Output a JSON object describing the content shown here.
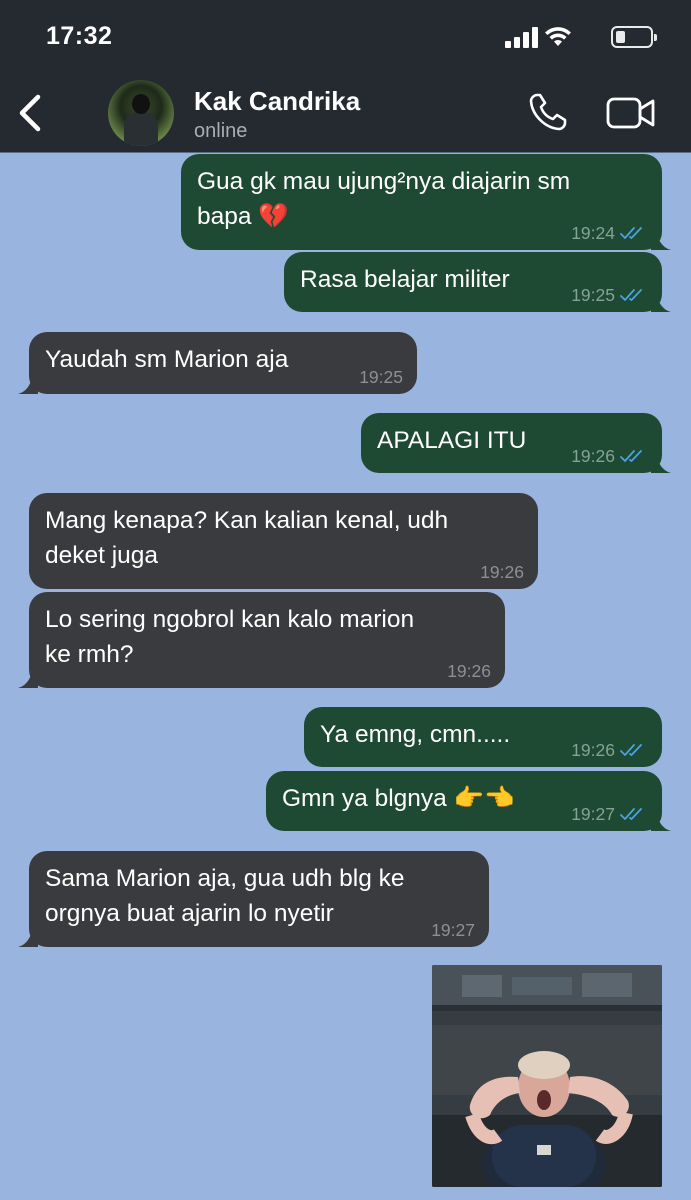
{
  "status_bar": {
    "time": "17:32",
    "battery_level": 0.3
  },
  "header": {
    "contact_name": "Kak Candrika",
    "contact_status": "online"
  },
  "colors": {
    "chat_background": "#98b4df",
    "outgoing_bubble": "#1e4a33",
    "incoming_bubble": "#3a3b3e",
    "read_ticks": "#4aa3e0"
  },
  "messages": [
    {
      "direction": "out",
      "text": "Gua gk mau ujung²nya diajarin sm\nbapa 💔",
      "time": "19:24",
      "read": true
    },
    {
      "direction": "out",
      "text": "Rasa belajar militer",
      "time": "19:25",
      "read": true
    },
    {
      "direction": "in",
      "text": "Yaudah sm Marion aja",
      "time": "19:25"
    },
    {
      "direction": "out",
      "text": "APALAGI ITU",
      "time": "19:26",
      "read": true
    },
    {
      "direction": "in",
      "text": "Mang kenapa? Kan kalian kenal, udh\ndeket juga",
      "time": "19:26"
    },
    {
      "direction": "in",
      "text": "Lo sering ngobrol kan kalo marion\nke rmh?",
      "time": "19:26"
    },
    {
      "direction": "out",
      "text": "Ya emng, cmn.....",
      "time": "19:26",
      "read": true
    },
    {
      "direction": "out",
      "text": "Gmn ya blgnya 👉👈",
      "time": "19:27",
      "read": true
    },
    {
      "direction": "in",
      "text": "Sama Marion aja, gua udh blg ke\norgnya buat ajarin lo nyetir",
      "time": "19:27"
    }
  ],
  "attachment": {
    "type": "photo",
    "description_icon": "reaction-photo"
  }
}
